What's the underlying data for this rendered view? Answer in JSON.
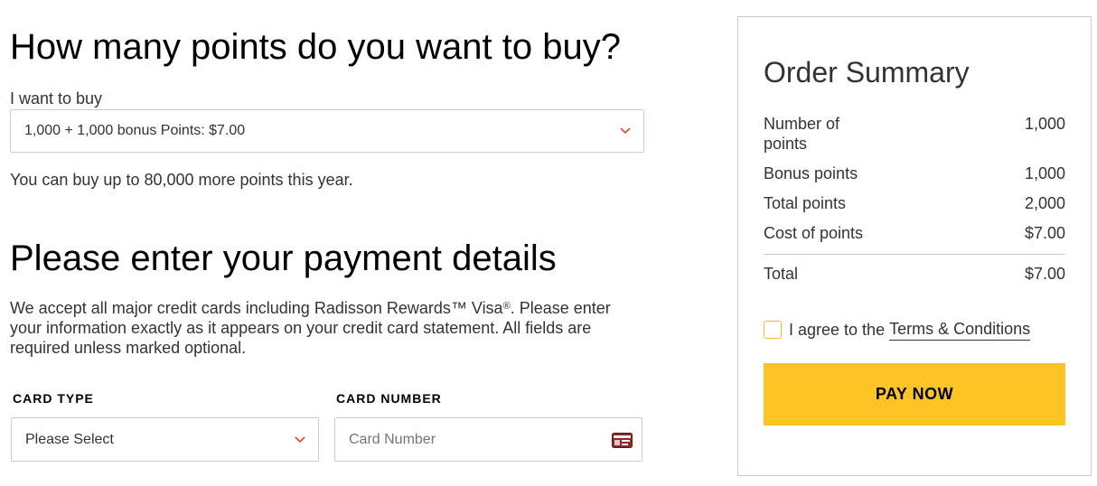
{
  "points_section": {
    "title": "How many points do you want to buy?",
    "buy_label": "I want to buy",
    "selected_option": "1,000 + 1,000 bonus Points: $7.00",
    "limit_note": "You can buy up to 80,000 more points this year."
  },
  "payment_section": {
    "title": "Please enter your payment details",
    "description_part1": "We accept all major credit cards including Radisson Rewards™ Visa",
    "description_reg": "®",
    "description_part2": ". Please enter your information exactly as it appears on your credit card statement. All fields are required unless marked optional.",
    "card_type_label": "CARD TYPE",
    "card_type_value": "Please Select",
    "card_number_label": "CARD NUMBER",
    "card_number_placeholder": "Card Number"
  },
  "order_summary": {
    "title": "Order Summary",
    "rows": [
      {
        "label": "Number of points",
        "value": "1,000"
      },
      {
        "label": "Bonus points",
        "value": "1,000"
      },
      {
        "label": "Total points",
        "value": "2,000"
      },
      {
        "label": "Cost of points",
        "value": "$7.00"
      }
    ],
    "total_label": "Total",
    "total_value": "$7.00",
    "agree_text": "I agree to the",
    "terms_link": "Terms & Conditions",
    "pay_button": "PAY NOW"
  },
  "colors": {
    "accent_yellow": "#fec425",
    "chevron_red": "#e0443a",
    "border_gray": "#cccccc"
  },
  "icons": [
    "chevron-down-icon",
    "credit-card-icon"
  ]
}
